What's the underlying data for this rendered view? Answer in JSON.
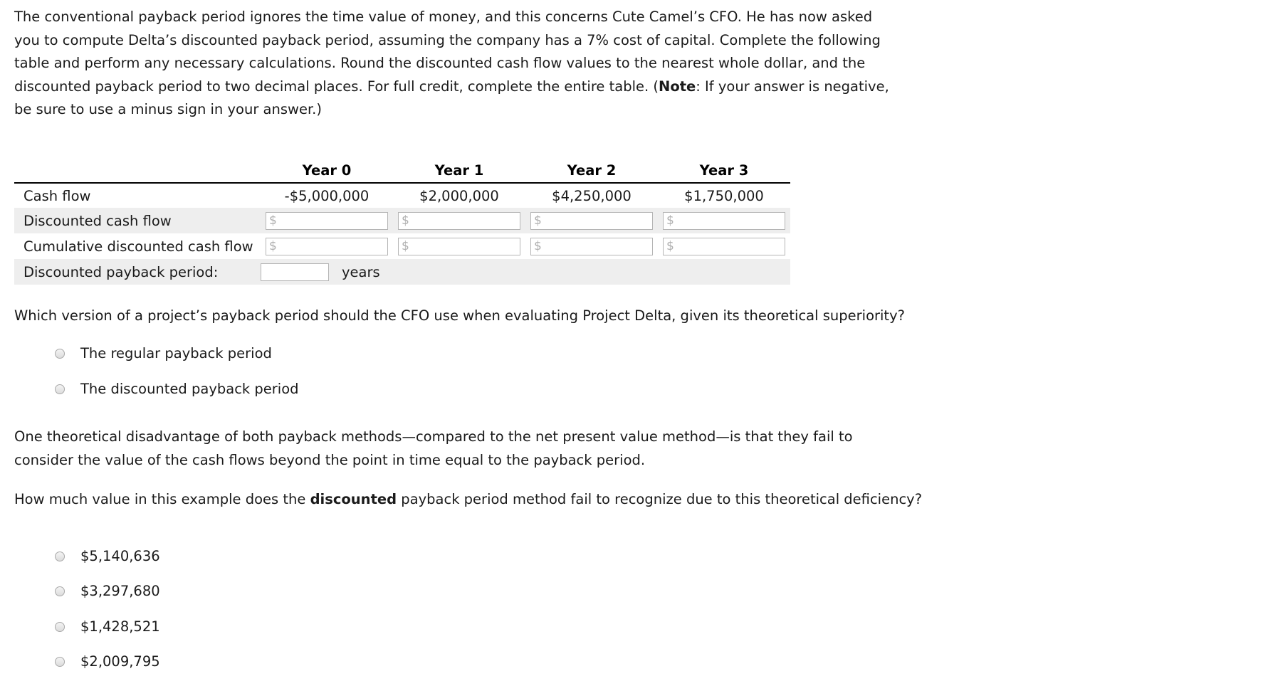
{
  "intro": {
    "part1": "The conventional payback period ignores the time value of money, and this concerns Cute Camel’s CFO. He has now asked you to compute Delta’s discounted payback period, assuming the company has a 7% cost of capital. Complete the following table and perform any necessary calculations. Round the discounted cash flow values to the nearest whole dollar, and the discounted payback period to two decimal places. For full credit, complete the entire table. (",
    "note_bold": "Note",
    "part2": ": If your answer is negative, be sure to use a minus sign in your answer.)"
  },
  "table": {
    "row_label_blank": "",
    "headers": [
      "Year 0",
      "Year 1",
      "Year 2",
      "Year 3"
    ],
    "rows": [
      {
        "label": "Cash flow",
        "type": "values",
        "values": [
          "-$5,000,000",
          "$2,000,000",
          "$4,250,000",
          "$1,750,000"
        ]
      },
      {
        "label": "Discounted cash flow",
        "type": "inputs",
        "values": [
          "",
          "",
          "",
          ""
        ],
        "placeholders": [
          "$",
          "$",
          "$",
          "$"
        ]
      },
      {
        "label": "Cumulative discounted cash flow",
        "type": "inputs",
        "values": [
          "",
          "",
          "",
          ""
        ],
        "placeholders": [
          "$",
          "$",
          "$",
          "$"
        ]
      }
    ],
    "payback": {
      "label": "Discounted payback period:",
      "value": "",
      "placeholder": "",
      "unit": "years"
    }
  },
  "question1": {
    "prompt": "Which version of a project’s payback period should the CFO use when evaluating Project Delta, given its theoretical superiority?",
    "options": [
      {
        "label": "The regular payback period",
        "selected": false
      },
      {
        "label": "The discounted payback period",
        "selected": false
      }
    ]
  },
  "paragraph2": "One theoretical disadvantage of both payback methods—compared to the net present value method—is that they fail to consider the value of the cash flows beyond the point in time equal to the payback period.",
  "question2": {
    "prompt_part1": "How much value in this example does the ",
    "prompt_bold": "discounted",
    "prompt_part2": " payback period method fail to recognize due to this theoretical deficiency?",
    "options": [
      {
        "label": "$5,140,636",
        "selected": false
      },
      {
        "label": "$3,297,680",
        "selected": false
      },
      {
        "label": "$1,428,521",
        "selected": false
      },
      {
        "label": "$2,009,795",
        "selected": false
      }
    ]
  },
  "colors": {
    "shaded_row": "#eeeeee",
    "rule": "#000000",
    "input_border": "#b5b5b5",
    "placeholder": "#b0b0b0"
  }
}
